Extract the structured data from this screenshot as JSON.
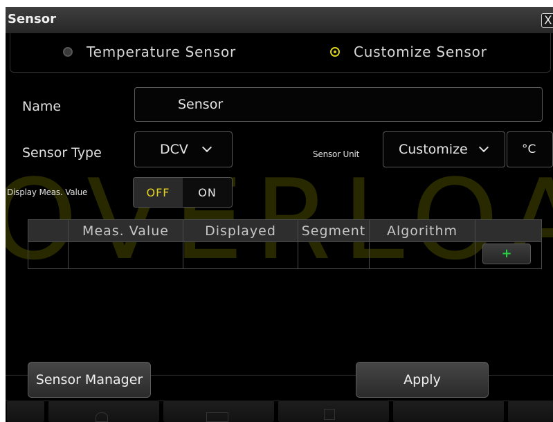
{
  "dialog": {
    "title": "Sensor",
    "close_glyph": "X"
  },
  "sensor_mode": {
    "options": [
      {
        "label": "Temperature Sensor",
        "selected": false
      },
      {
        "label": "Customize Sensor",
        "selected": true
      }
    ]
  },
  "form": {
    "name_label": "Name",
    "name_value": "Sensor",
    "sensor_type_label": "Sensor Type",
    "sensor_type_value": "DCV",
    "sensor_unit_label": "Sensor Unit",
    "sensor_unit_value": "Customize",
    "unit_symbol": "°C",
    "display_meas_label": "Display Meas. Value",
    "toggle": {
      "off_label": "OFF",
      "on_label": "ON",
      "active": "OFF"
    }
  },
  "watermark": "OVERLOAD",
  "table": {
    "headers": [
      "",
      "Meas. Value",
      "Displayed",
      "Segment",
      "Algorithm",
      ""
    ],
    "add_glyph": "+"
  },
  "buttons": {
    "sensor_manager": "Sensor Manager",
    "apply": "Apply"
  },
  "colors": {
    "accent_yellow": "#e6d41d",
    "add_green": "#27d040",
    "background": "#000000",
    "titlebar": "#333333"
  },
  "icons": [
    "close-icon",
    "chevron-down-icon",
    "plus-icon",
    "radio-selected-icon",
    "radio-unselected-icon"
  ]
}
